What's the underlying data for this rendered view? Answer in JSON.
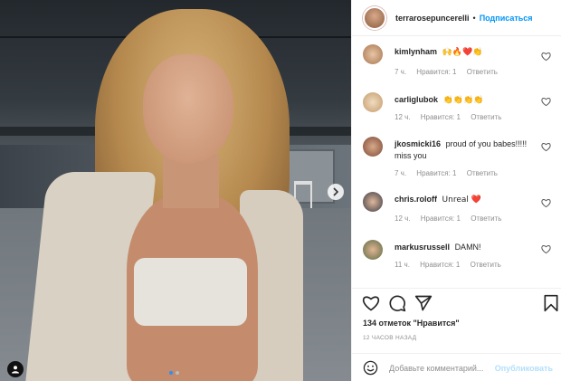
{
  "post": {
    "carousel": {
      "total_slides": 2,
      "active_slide": 1
    },
    "next_icon": "chevron-right-icon",
    "tag_icon": "person-tag-icon"
  },
  "header": {
    "username": "terrarosepuncerelli",
    "separator": "•",
    "follow_label": "Подписаться"
  },
  "comments": [
    {
      "username": "kimlynham",
      "text": "🙌🔥❤️👏",
      "time": "7 ч.",
      "likes": "Нравится: 1",
      "reply": "Ответить"
    },
    {
      "username": "carliglubok",
      "text": "👏👏👏👏",
      "time": "12 ч.",
      "likes": "Нравится: 1",
      "reply": "Ответить"
    },
    {
      "username": "jkosmicki16",
      "text": "proud of you babes!!!!! miss you",
      "time": "7 ч.",
      "likes": "Нравится: 1",
      "reply": "Ответить"
    },
    {
      "username": "chris.roloff",
      "text": "Unreal ❤️",
      "time": "12 ч.",
      "likes": "Нравится: 1",
      "reply": "Ответить"
    },
    {
      "username": "markusrussell",
      "text": "DAMN!",
      "time": "11 ч.",
      "likes": "Нравится: 1",
      "reply": "Ответить"
    }
  ],
  "actions": {
    "like_icon": "heart-icon",
    "comment_icon": "comment-icon",
    "share_icon": "send-icon",
    "save_icon": "bookmark-icon"
  },
  "likes_text": "134 отметок \"Нравится\"",
  "time_ago": "12 ЧАСОВ НАЗАД",
  "add_comment": {
    "placeholder": "Добавьте комментарий...",
    "publish_label": "Опубликовать"
  },
  "colors": {
    "accent": "#0095f6",
    "publish_disabled": "#b2dffc",
    "heart_red": "#ed4956"
  }
}
